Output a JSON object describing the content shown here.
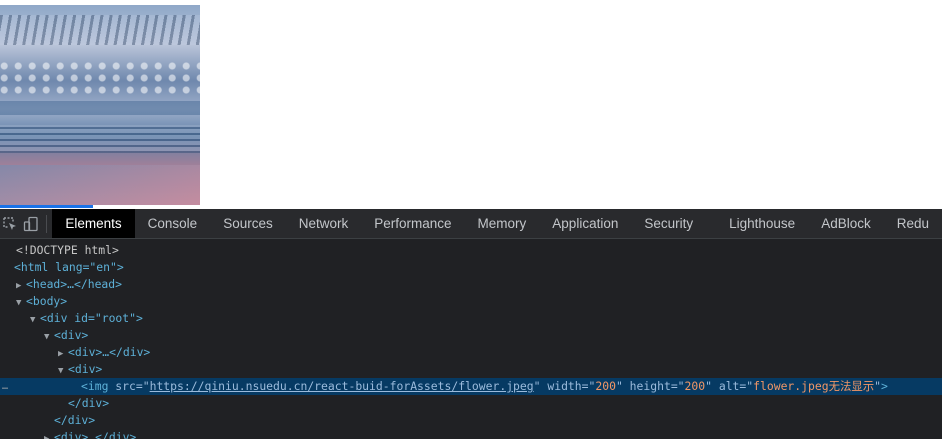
{
  "page": {
    "image_alt": "flower.jpeg无法显示"
  },
  "devtools": {
    "tabs": [
      "Elements",
      "Console",
      "Sources",
      "Network",
      "Performance",
      "Memory",
      "Application",
      "Security",
      "Lighthouse",
      "AdBlock",
      "Redu"
    ],
    "active_tab": "Elements",
    "icons": [
      "inspect-element-icon",
      "device-toolbar-icon"
    ],
    "accent_color": "#1a73e8",
    "selected_row_color": "#063a63",
    "dom": {
      "doctype": "<!DOCTYPE html>",
      "html_open": "<html lang=\"en\">",
      "head": "<head>…</head>",
      "body_open": "<body>",
      "root_div": "<div id=\"root\">",
      "div": "<div>",
      "div_collapsed": "<div>…</div>",
      "img": {
        "tag": "img",
        "src_attr": "src",
        "src": "https://qiniu.nsuedu.cn/react-buid-forAssets/flower.jpeg",
        "width_attr": "width",
        "width": "200",
        "height_attr": "height",
        "height": "200",
        "alt_attr": "alt",
        "alt": "flower.jpeg无法显示"
      },
      "div_close": "</div>",
      "ellipsis_marker": "…"
    }
  }
}
